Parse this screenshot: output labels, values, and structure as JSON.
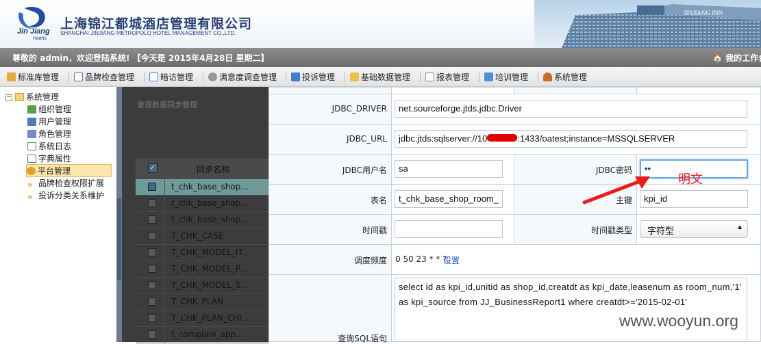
{
  "header": {
    "logo_text": "Jin Jiang",
    "logo_sub": "Hotels",
    "company_cn": "上海锦江都城酒店管理有限公司",
    "company_en": "SHANGHAI JINJIANG METROPOLO HOTEL MANAGEMENT CO.,LTD.",
    "building_sign": "JINJIANG INN"
  },
  "welcome": {
    "text": "尊敬的 admin，欢迎登陆系统! 【今天是 2015年4月28日 星期二】",
    "workbench": "我的工作台"
  },
  "menu": [
    {
      "label": "标准库管理",
      "icon": "box-icon",
      "color": "#e8a93b"
    },
    {
      "label": "品牌检查管理",
      "icon": "window-icon",
      "color": "#3f7fcf"
    },
    {
      "label": "暗访管理",
      "icon": "calendar-icon",
      "color": "#3f7fcf"
    },
    {
      "label": "满意度调查管理",
      "icon": "gear-icon",
      "color": "#888888"
    },
    {
      "label": "投诉管理",
      "icon": "document-icon",
      "color": "#3f7fcf"
    },
    {
      "label": "基础数据管理",
      "icon": "folder-icon",
      "color": "#e8c04a"
    },
    {
      "label": "报表管理",
      "icon": "report-icon",
      "color": "#6a9bd8"
    },
    {
      "label": "培训管理",
      "icon": "monitor-icon",
      "color": "#4f8fd8"
    },
    {
      "label": "系统管理",
      "icon": "user-icon",
      "color": "#d06a2a"
    }
  ],
  "tree": {
    "root": "系统管理",
    "items": [
      {
        "label": "组织管理",
        "icon": "org-icon"
      },
      {
        "label": "用户管理",
        "icon": "user-icon"
      },
      {
        "label": "角色管理",
        "icon": "role-icon"
      },
      {
        "label": "系统日志",
        "icon": "log-icon"
      },
      {
        "label": "字典属性",
        "icon": "dict-icon"
      },
      {
        "label": "平台管理",
        "icon": "platform-icon",
        "selected": true
      },
      {
        "label": "品牌检查权限扩展",
        "icon": "expand-icon"
      },
      {
        "label": "投诉分类关系维护",
        "icon": "expand-icon"
      }
    ]
  },
  "background_list": {
    "title": "管理数据同步管理",
    "column": "同步名称",
    "rows": [
      {
        "name": "t_chk_base_shop...",
        "checked": true
      },
      {
        "name": "t_chk_base_shop..."
      },
      {
        "name": "t_chk_base_shop..."
      },
      {
        "name": "T_CHK_CASE"
      },
      {
        "name": "T_CHK_MODEL_IT..."
      },
      {
        "name": "T_CHK_MODEL_P..."
      },
      {
        "name": "T_CHK_MODEL_S..."
      },
      {
        "name": "T_CHK_PLAN"
      },
      {
        "name": "T_CHK_PLAN_CHI..."
      },
      {
        "name": "t_complain_app..."
      }
    ]
  },
  "form": {
    "jdbc_driver_label": "JDBC_DRIVER",
    "jdbc_driver_value": "net.sourceforge.jtds.jdbc.Driver",
    "jdbc_url_label": "JDBC_URL",
    "jdbc_url_prefix": "jdbc:jtds:sqlserver://10",
    "jdbc_url_suffix": ":1433/oatest;instance=MSSQLSERVER",
    "jdbc_user_label": "JDBC用户名",
    "jdbc_user_value": "sa",
    "jdbc_password_label": "JDBC密码",
    "jdbc_password_value": "••",
    "table_label": "表名",
    "table_value": "t_chk_base_shop_room_",
    "primary_key_label": "主键",
    "primary_key_value": "kpi_id",
    "timestamp_label": "时间戳",
    "timestamp_value": "",
    "timestamp_type_label": "时间戳类型",
    "timestamp_type_value": "字符型",
    "schedule_label": "调度频度",
    "schedule_value": "0 50 23 * * ?",
    "schedule_link": "设置",
    "sql_label": "查询SQL语句",
    "sql_value": "select id as kpi_id,unitid as shop_id,creatdt as kpi_date,leasenum as room_num,'1' as kpi_source from JJ_BusinessReport1 where creatdt>='2015-02-01'"
  },
  "annotation": "明文",
  "watermark": "www.wooyun.org"
}
